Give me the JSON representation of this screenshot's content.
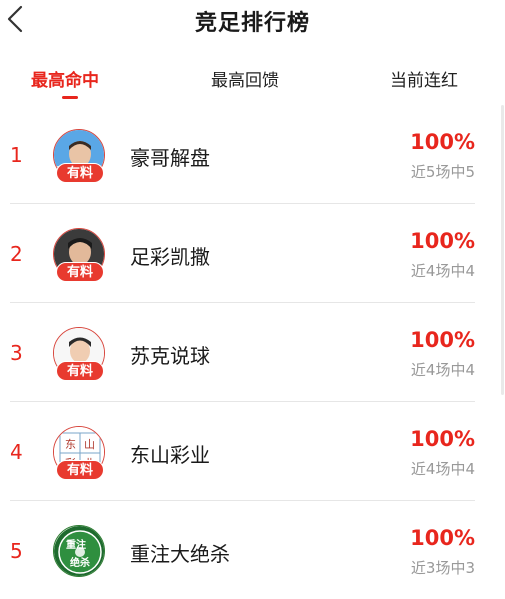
{
  "header": {
    "title": "竞足排行榜"
  },
  "tabs": [
    {
      "label": "最高命中"
    },
    {
      "label": "最高回馈"
    },
    {
      "label": "当前连红"
    }
  ],
  "badge_label": "有料",
  "accent_color": "#e8261d",
  "rows": [
    {
      "rank": "1",
      "name": "豪哥解盘",
      "percent": "100%",
      "record": "近5场中5"
    },
    {
      "rank": "2",
      "name": "足彩凯撒",
      "percent": "100%",
      "record": "近4场中4"
    },
    {
      "rank": "3",
      "name": "苏克说球",
      "percent": "100%",
      "record": "近4场中4"
    },
    {
      "rank": "4",
      "name": "东山彩业",
      "percent": "100%",
      "record": "近4场中4"
    },
    {
      "rank": "5",
      "name": "重注大绝杀",
      "percent": "100%",
      "record": "近3场中3"
    }
  ],
  "avatars": {
    "row4_logo_text": [
      "东",
      "山",
      "彩",
      "业"
    ],
    "row5_logo_text": [
      "重注",
      "绝杀"
    ]
  }
}
